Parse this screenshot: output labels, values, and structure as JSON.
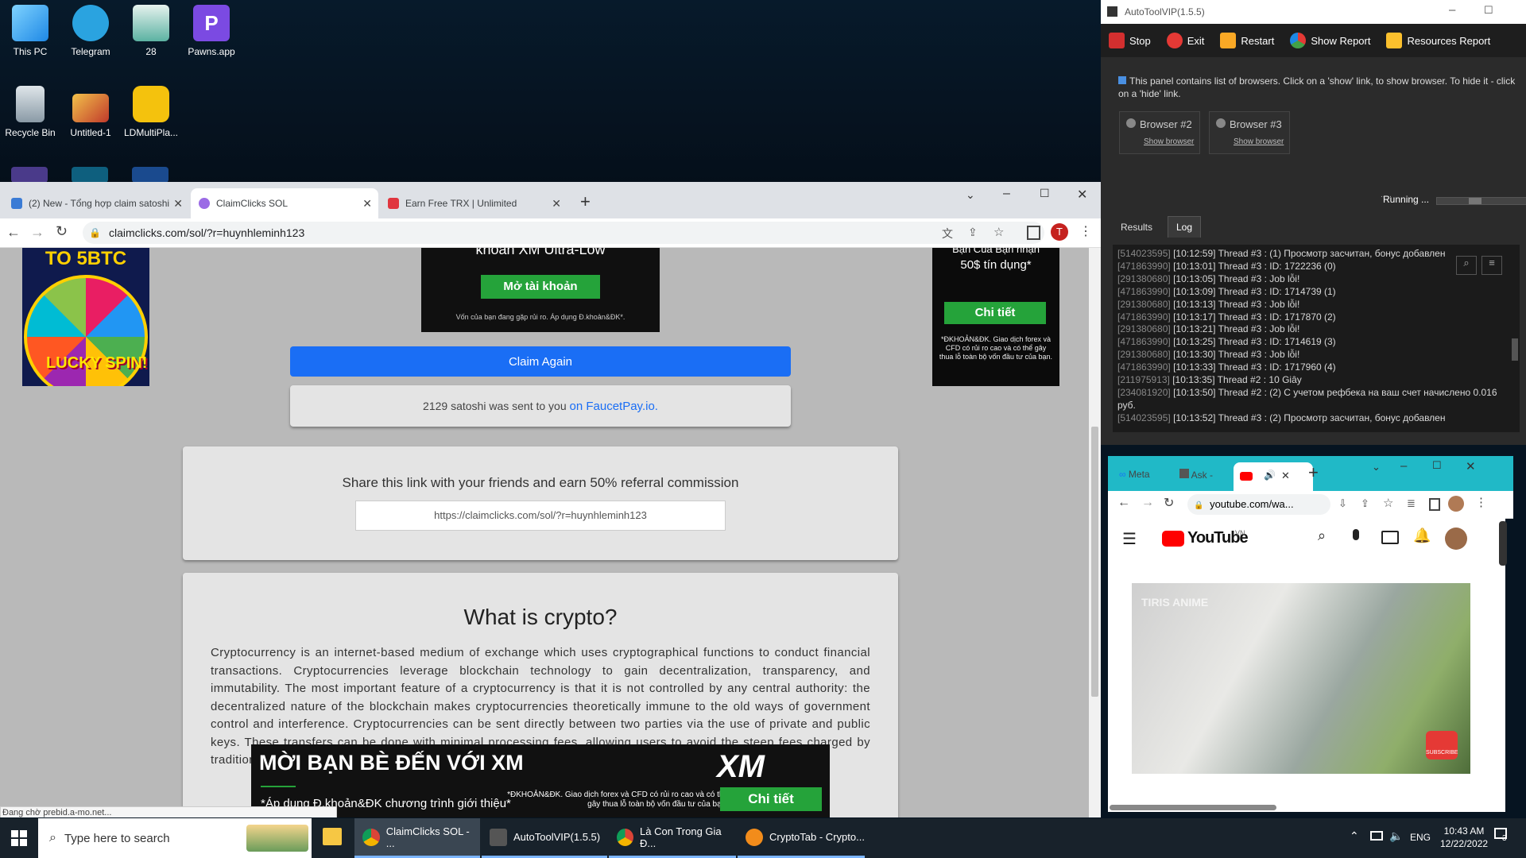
{
  "desktop": {
    "icons": [
      {
        "label": "This PC"
      },
      {
        "label": "Telegram"
      },
      {
        "label": "28"
      },
      {
        "label": "Pawns.app"
      },
      {
        "label": "Recycle Bin"
      },
      {
        "label": "Untitled-1"
      },
      {
        "label": "LDMultiPla..."
      }
    ]
  },
  "chrome": {
    "tabs": [
      {
        "label": "(2) New - Tổng hợp claim satoshi"
      },
      {
        "label": "ClaimClicks SOL"
      },
      {
        "label": "Earn Free TRX | Unlimited"
      }
    ],
    "url": "claimclicks.com/sol/?r=huynhleminh123",
    "avatar": "T",
    "status": "Đang chờ prebid.a-mo.net..."
  },
  "page": {
    "ad_top_line": "khoản XM Ultra-Low",
    "ad_top_button": "Mở tài khoản",
    "ad_top_note": "Vốn của bạn đang gặp rủi ro. Áp dụng Đ.khoản&ĐK*.",
    "left_ad_title": "TO 5BTC",
    "left_ad_spin": "LUCKY SPIN!",
    "right_ad_line1": "Bạn Của Bạn nhận",
    "right_ad_line2": "50$ tín dụng*",
    "right_ad_button": "Chi tiết",
    "right_ad_note": "*ĐKHOẢN&ĐK. Giao dịch forex và CFD có rủi ro cao và có thể gây thua lỗ toàn bộ vốn đầu tư của bạn.",
    "claim_again": "Claim Again",
    "sent_text": "2129 satoshi was sent to you",
    "sent_link": "on FaucetPay.io.",
    "share_title": "Share this link with your friends and earn 50% referral commission",
    "share_link": "https://claimclicks.com/sol/?r=huynhleminh123",
    "crypto_title": "What is crypto?",
    "crypto_text": "Cryptocurrency is an internet-based medium of exchange which uses cryptographical functions to conduct financial transactions. Cryptocurrencies leverage blockchain technology to gain decentralization, transparency, and immutability. The most important feature of a cryptocurrency is that it is not controlled by any central authority: the decentralized nature of the blockchain makes cryptocurrencies theoretically immune to the old ways of government control and interference. Cryptocurrencies can be sent directly between two parties via the use of private and public keys. These transfers can be done with minimal processing fees, allowing users to avoid the steep fees charged by traditional financial institutions.",
    "bottom_ad_title": "MỜI BẠN BÈ ĐẾN VỚI XM",
    "bottom_ad_sub": "*Áp dụng Đ.khoản&ĐK chương trình giới thiệu*",
    "bottom_ad_note": "*ĐKHOẢN&ĐK. Giao dịch forex và CFD có rủi ro cao và có thể gây thua lỗ toàn bộ vốn đầu tư của bạn.",
    "bottom_ad_button": "Chi tiết",
    "bottom_ad_logo": "XM"
  },
  "tool": {
    "title": "AutoToolVIP(1.5.5)",
    "buttons": [
      "Stop",
      "Exit",
      "Restart",
      "Show Report",
      "Resources Report"
    ],
    "info": "This panel contains list of browsers. Click on a 'show' link, to show browser. To hide it - click on a 'hide' link.",
    "browsers": [
      {
        "name": "Browser #2",
        "link": "Show browser"
      },
      {
        "name": "Browser #3",
        "link": "Show browser"
      }
    ],
    "running": "Running ...",
    "tabs": [
      "Results",
      "Log"
    ],
    "log": [
      {
        "id": "[514023595]",
        "text": "[10:12:59] Thread #3 : (1) Просмотр засчитан, бонус добавлен"
      },
      {
        "id": "[471863990]",
        "text": "[10:13:01] Thread #3 : ID: 1722236 (0)"
      },
      {
        "id": "[291380680]",
        "text": "[10:13:05] Thread #3 : Job lỗi!"
      },
      {
        "id": "[471863990]",
        "text": "[10:13:09] Thread #3 : ID: 1714739 (1)"
      },
      {
        "id": "[291380680]",
        "text": "[10:13:13] Thread #3 : Job lỗi!"
      },
      {
        "id": "[471863990]",
        "text": "[10:13:17] Thread #3 : ID: 1717870 (2)"
      },
      {
        "id": "[291380680]",
        "text": "[10:13:21] Thread #3 : Job lỗi!"
      },
      {
        "id": "[471863990]",
        "text": "[10:13:25] Thread #3 : ID: 1714619 (3)"
      },
      {
        "id": "[291380680]",
        "text": "[10:13:30] Thread #3 : Job lỗi!"
      },
      {
        "id": "[471863990]",
        "text": "[10:13:33] Thread #3 : ID: 1717960 (4)"
      },
      {
        "id": "[211975913]",
        "text": "[10:13:35] Thread #2 : 10 Giây"
      },
      {
        "id": "[234081920]",
        "text": "[10:13:50] Thread #2 : (2) С учетом рефбека на ваш счет начислено 0.016 руб."
      },
      {
        "id": "[514023595]",
        "text": "[10:13:52] Thread #3 : (2) Просмотр засчитан, бонус добавлен"
      }
    ]
  },
  "youtube": {
    "tabs": [
      "Meta",
      "Ask -"
    ],
    "url": "youtube.com/wa...",
    "logo": "YouTube",
    "region": "VN",
    "watermark": "TIRIS ANIME",
    "subscribe": "SUBSCRIBE"
  },
  "taskbar": {
    "search": "Type here to search",
    "apps": [
      "ClaimClicks SOL - ...",
      "AutoToolVIP(1.5.5)",
      "Là Con Trong Gia Đ...",
      "CryptoTab - Crypto..."
    ],
    "lang": "ENG",
    "time": "10:43 AM",
    "date": "12/22/2022",
    "notif": "3"
  }
}
